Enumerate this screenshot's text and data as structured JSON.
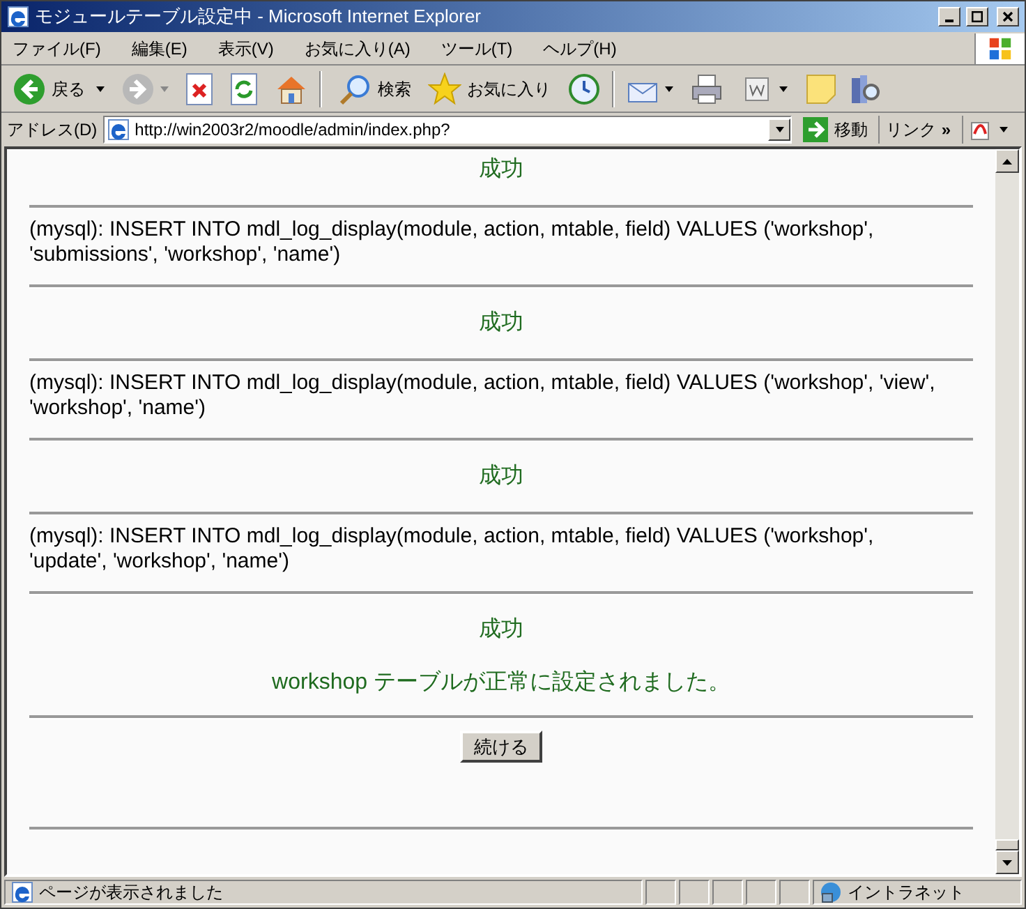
{
  "window": {
    "title": "モジュールテーブル設定中 - Microsoft Internet Explorer"
  },
  "menu": [
    "ファイル(F)",
    "編集(E)",
    "表示(V)",
    "お気に入り(A)",
    "ツール(T)",
    "ヘルプ(H)"
  ],
  "toolbar": {
    "back": "戻る",
    "search": "検索",
    "favorites": "お気に入り"
  },
  "address_bar": {
    "label": "アドレス(D)",
    "url": "http://win2003r2/moodle/admin/index.php?",
    "go": "移動",
    "links": "リンク",
    "chevron": "»"
  },
  "content": [
    {
      "kind": "success",
      "text": "成功"
    },
    {
      "kind": "rule"
    },
    {
      "kind": "sql",
      "text": "(mysql): INSERT INTO mdl_log_display(module, action, mtable, field) VALUES ('workshop', 'submissions', 'workshop', 'name')"
    },
    {
      "kind": "rule"
    },
    {
      "kind": "success",
      "text": "成功"
    },
    {
      "kind": "rule"
    },
    {
      "kind": "sql",
      "text": "(mysql): INSERT INTO mdl_log_display(module, action, mtable, field) VALUES ('workshop', 'view', 'workshop', 'name')"
    },
    {
      "kind": "rule"
    },
    {
      "kind": "success",
      "text": "成功"
    },
    {
      "kind": "rule"
    },
    {
      "kind": "sql",
      "text": "(mysql): INSERT INTO mdl_log_display(module, action, mtable, field) VALUES ('workshop', 'update', 'workshop', 'name')"
    },
    {
      "kind": "rule"
    },
    {
      "kind": "success",
      "text": "成功"
    },
    {
      "kind": "message",
      "text": "workshop テーブルが正常に設定されました。"
    },
    {
      "kind": "rule"
    },
    {
      "kind": "button",
      "text": "続ける"
    },
    {
      "kind": "rule"
    }
  ],
  "status_bar": {
    "text": "ページが表示されました",
    "zone": "イントラネット"
  }
}
